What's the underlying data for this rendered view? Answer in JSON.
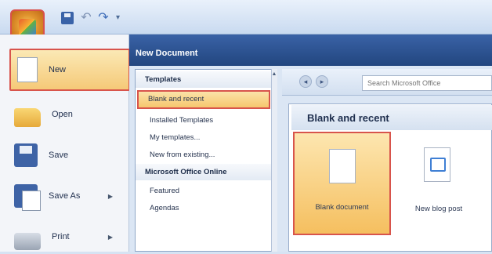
{
  "quick_access": {
    "save_icon": "save-icon",
    "undo_icon": "undo-icon",
    "redo_icon": "redo-icon",
    "undo_glyph": "↶",
    "redo_glyph": "↷",
    "more_glyph": "▾"
  },
  "office_menu": {
    "items": [
      {
        "label": "New",
        "icon": "new-document-icon",
        "selected": true
      },
      {
        "label": "Open",
        "icon": "open-folder-icon"
      },
      {
        "label": "Save",
        "icon": "save-disk-icon"
      },
      {
        "label": "Save As",
        "icon": "save-as-icon",
        "submenu": true
      },
      {
        "label": "Print",
        "icon": "printer-icon",
        "submenu": true
      }
    ],
    "submenu_arrow": "▶"
  },
  "dialog": {
    "title": "New Document"
  },
  "templates": {
    "header": "Templates",
    "items": [
      "Blank and recent",
      "Installed Templates",
      "My templates...",
      "New from existing..."
    ],
    "section": "Microsoft Office Online",
    "online_items": [
      "Featured",
      "Agendas"
    ],
    "scroll_up": "▲"
  },
  "search": {
    "placeholder": "Search Microsoft Office",
    "back": "◂",
    "forward": "▸"
  },
  "content": {
    "heading": "Blank and recent",
    "tiles": [
      "Blank document",
      "New blog post"
    ]
  },
  "colors": {
    "highlight_border": "#d8544c",
    "selected_fill": "#f5c978",
    "dialog_title_bg": "#2c5291"
  }
}
